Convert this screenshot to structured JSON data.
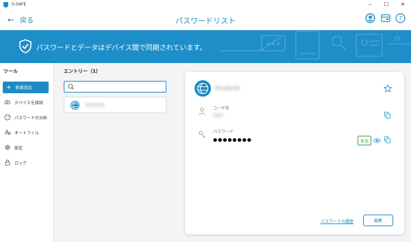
{
  "window": {
    "app_name": "S-SAFE",
    "controls": [
      "–",
      "☐",
      "✕"
    ]
  },
  "header": {
    "back_label": "戻る",
    "title": "パスワードリスト",
    "dot": "·"
  },
  "banner": {
    "message": "パスワードとデータはデバイス間で同期されています。"
  },
  "sidebar": {
    "heading": "ツール",
    "new_button": "新規追加",
    "items": [
      {
        "label": "デバイスを接続",
        "icon": "cloud-upload-icon"
      },
      {
        "label": "パスワードの分析",
        "icon": "gauge-icon"
      },
      {
        "label": "オートフィル",
        "icon": "autofill-icon"
      },
      {
        "label": "設定",
        "icon": "gear-icon"
      },
      {
        "label": "ロック",
        "icon": "lock-icon"
      }
    ]
  },
  "list": {
    "heading": "エントリー（1）",
    "search_placeholder": "",
    "entries": [
      {
        "name": "facebook"
      }
    ]
  },
  "detail": {
    "title": "facebook",
    "username_label": "ユーザ名",
    "username_value": "user",
    "password_label": "パスワード",
    "password_value": "●●●●●●●●",
    "safe_badge": "安全",
    "history_link": "パスワードの履歴",
    "edit_button": "編集"
  },
  "colors": {
    "accent": "#1c8bc4",
    "banner": "#1e8ec8",
    "safe": "#3aa546"
  }
}
